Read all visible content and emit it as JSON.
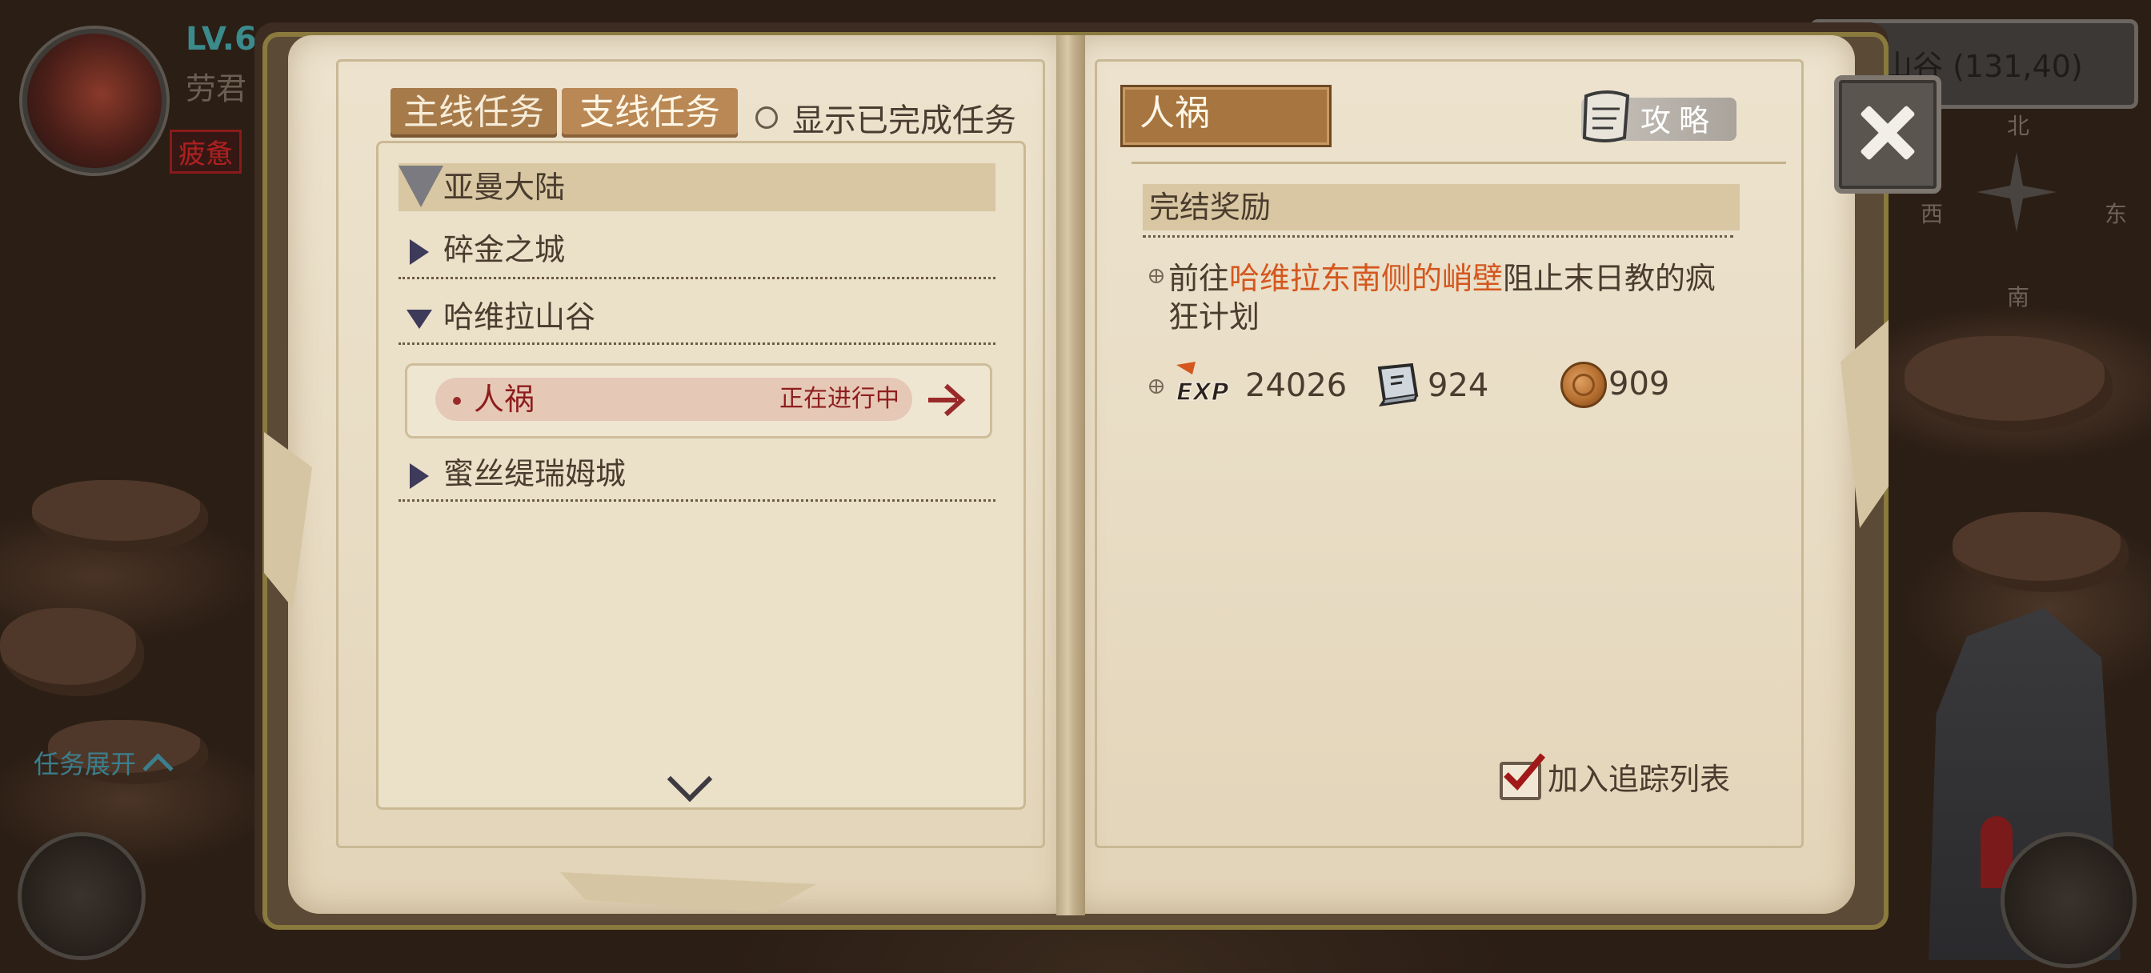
{
  "hud": {
    "level": "LV.6",
    "player_name": "劳君",
    "status_badge": "疲惫",
    "task_expand_label": "任务展开",
    "location_text": "山谷  (131,40)",
    "compass": {
      "north": "北",
      "south": "南",
      "west": "西",
      "east": "东"
    }
  },
  "quest_log": {
    "tabs": {
      "main": "主线任务",
      "side": "支线任务"
    },
    "show_completed_label": "显示已完成任务",
    "regions": [
      {
        "name": "亚曼大陆"
      },
      {
        "name": "碎金之城"
      },
      {
        "name": "哈维拉山谷"
      },
      {
        "name": "蜜丝缇瑞姆城"
      }
    ],
    "active_quest": {
      "name": "人祸",
      "status": "正在进行中"
    }
  },
  "quest_detail": {
    "title": "人祸",
    "guide_label": "攻略",
    "reward_header": "完结奖励",
    "description": {
      "before": "前往",
      "highlight": "哈维拉东南侧的峭壁",
      "after": "阻止末日教的疯狂计划"
    },
    "rewards": {
      "exp": "24026",
      "book": "924",
      "coin": "909"
    },
    "track_label": "加入追踪列表",
    "tracked": true
  },
  "colors": {
    "highlight": "#d4571e",
    "quest_active": "#8e1e1e",
    "tab_bg": "#a77a4a"
  },
  "icons": [
    "close-icon",
    "scroll-icon",
    "exp-icon",
    "book-icon",
    "coin-icon",
    "checkbox-icon",
    "arrow-right-icon",
    "chevron-down-icon"
  ]
}
